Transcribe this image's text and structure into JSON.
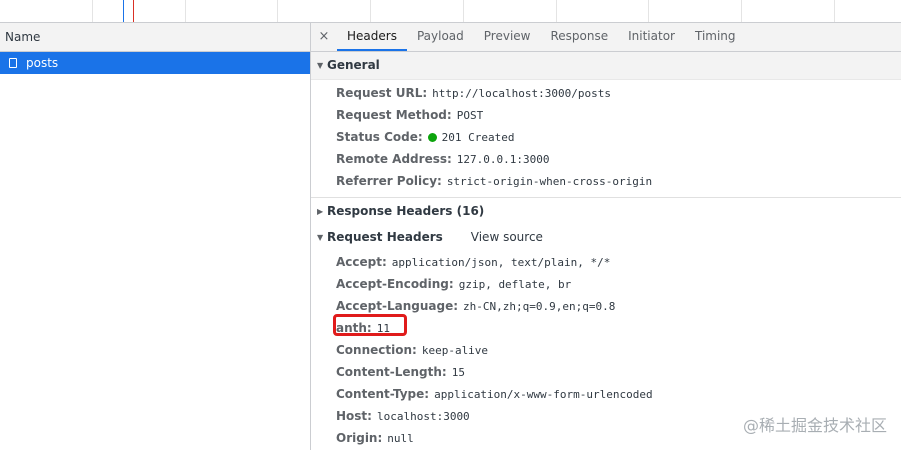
{
  "left_panel": {
    "column_header": "Name",
    "request_name": "posts"
  },
  "tabs": [
    {
      "label": "Headers",
      "active": true
    },
    {
      "label": "Payload",
      "active": false
    },
    {
      "label": "Preview",
      "active": false
    },
    {
      "label": "Response",
      "active": false
    },
    {
      "label": "Initiator",
      "active": false
    },
    {
      "label": "Timing",
      "active": false
    }
  ],
  "close_glyph": "×",
  "general": {
    "title": "General",
    "rows": [
      {
        "k": "Request URL:",
        "v": "http://localhost:3000/posts"
      },
      {
        "k": "Request Method:",
        "v": "POST"
      },
      {
        "k": "Status Code:",
        "v": "201 Created",
        "status_color": "#0ca40c"
      },
      {
        "k": "Remote Address:",
        "v": "127.0.0.1:3000"
      },
      {
        "k": "Referrer Policy:",
        "v": "strict-origin-when-cross-origin"
      }
    ]
  },
  "response_headers": {
    "title": "Response Headers (16)"
  },
  "request_headers": {
    "title": "Request Headers",
    "view_source": "View source",
    "rows": [
      {
        "k": "Accept:",
        "v": "application/json, text/plain, */*"
      },
      {
        "k": "Accept-Encoding:",
        "v": "gzip, deflate, br"
      },
      {
        "k": "Accept-Language:",
        "v": "zh-CN,zh;q=0.9,en;q=0.8"
      },
      {
        "k": "anth:",
        "v": "11"
      },
      {
        "k": "Connection:",
        "v": "keep-alive"
      },
      {
        "k": "Content-Length:",
        "v": "15"
      },
      {
        "k": "Content-Type:",
        "v": "application/x-www-form-urlencoded"
      },
      {
        "k": "Host:",
        "v": "localhost:3000"
      },
      {
        "k": "Origin:",
        "v": "null"
      }
    ]
  },
  "watermark": "@稀土掘金技术社区",
  "colors": {
    "accent": "#1a73e8",
    "highlight": "#e01b1b"
  }
}
